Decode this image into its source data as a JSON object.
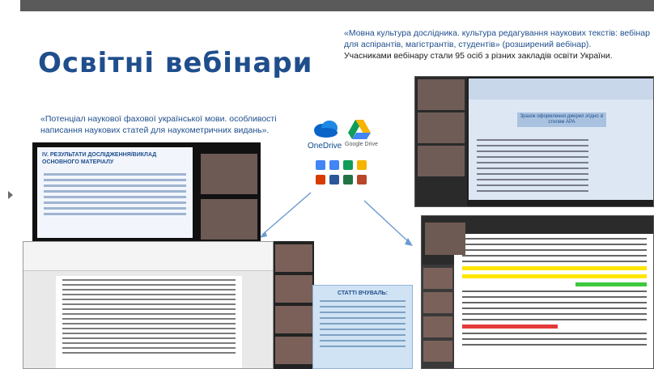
{
  "slide": {
    "title": "Освітні вебінари",
    "caption_left": "«Потенціал наукової фахової української мови. особливості написання наукових статей для наукометричних видань».",
    "caption_right": "«Мовна культура дослідника. культура редагування наукових текстів: вебінар для аспірантів, магістрантів,  студентів» (розширений вебінар).",
    "caption_right_extra": "Учасниками вебінару стали 95 осіб з різних закладів освіти України."
  },
  "cloud": {
    "onedrive_label": "OneDrive",
    "gdrive_label": "Google Drive",
    "icon_colors": [
      "#4285f4",
      "#4285f4",
      "#0f9d58",
      "#f4b400",
      "#d83b01",
      "#2b579a",
      "#217346",
      "#b7472a"
    ]
  },
  "screens": {
    "slide_a_title": "IV. РЕЗУЛЬТАТИ ДОСЛІДЖЕННЯ/ВИКЛАД ОСНОВНОГО МАТЕРІАЛУ",
    "slide_d_title": "СТАТТІ ВЧУВАЛЬ:",
    "slide_e_title": "Зразок оформлення джерел згідно зі стилем APA"
  },
  "colors": {
    "accent": "#1f4e8c",
    "topbar": "#5a5a5a"
  }
}
